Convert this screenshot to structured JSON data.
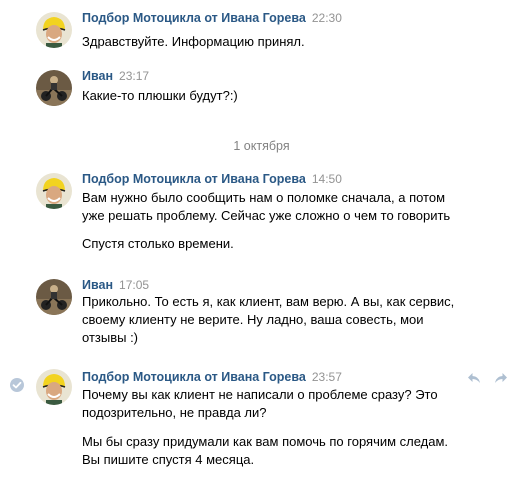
{
  "messages": [
    {
      "author": "Подбор Мотоцикла от Ивана Горева",
      "time": "22:30",
      "lines": [
        "Здравствуйте. Информацию принял."
      ]
    },
    {
      "author": "Иван",
      "time": "23:17",
      "lines": [
        "Какие-то плюшки будут?:)"
      ]
    },
    {
      "author": "Подбор Мотоцикла от Ивана Горева",
      "time": "14:50",
      "lines": [
        "Вам нужно было сообщить нам о поломке сначала, а потом",
        "уже решать проблему. Сейчас уже сложно о чем то говорить"
      ],
      "lines2": [
        "Спустя столько времени."
      ]
    },
    {
      "author": "Иван",
      "time": "17:05",
      "lines": [
        "Прикольно. То есть я, как клиент, вам верю. А вы, как сервис,",
        "своему клиенту не верите. Ну ладно, ваша совесть, мои",
        "отзывы :)"
      ]
    },
    {
      "author": "Подбор Мотоцикла от Ивана Горева",
      "time": "23:57",
      "lines": [
        "Почему вы как клиент не написали о проблеме сразу? Это",
        "подозрительно, не правда ли?"
      ],
      "lines2": [
        "Мы бы сразу придумали как вам помочь по горячим следам.",
        "Вы пишите спустя 4 месяца."
      ]
    }
  ],
  "date_divider": "1 октября",
  "icons": {
    "selected": "check-circle-icon",
    "reply": "reply-icon",
    "forward": "forward-icon"
  },
  "colors": {
    "author": "#2a5885",
    "time": "#939393",
    "divider_text": "#828282",
    "check": "#5181b8"
  }
}
